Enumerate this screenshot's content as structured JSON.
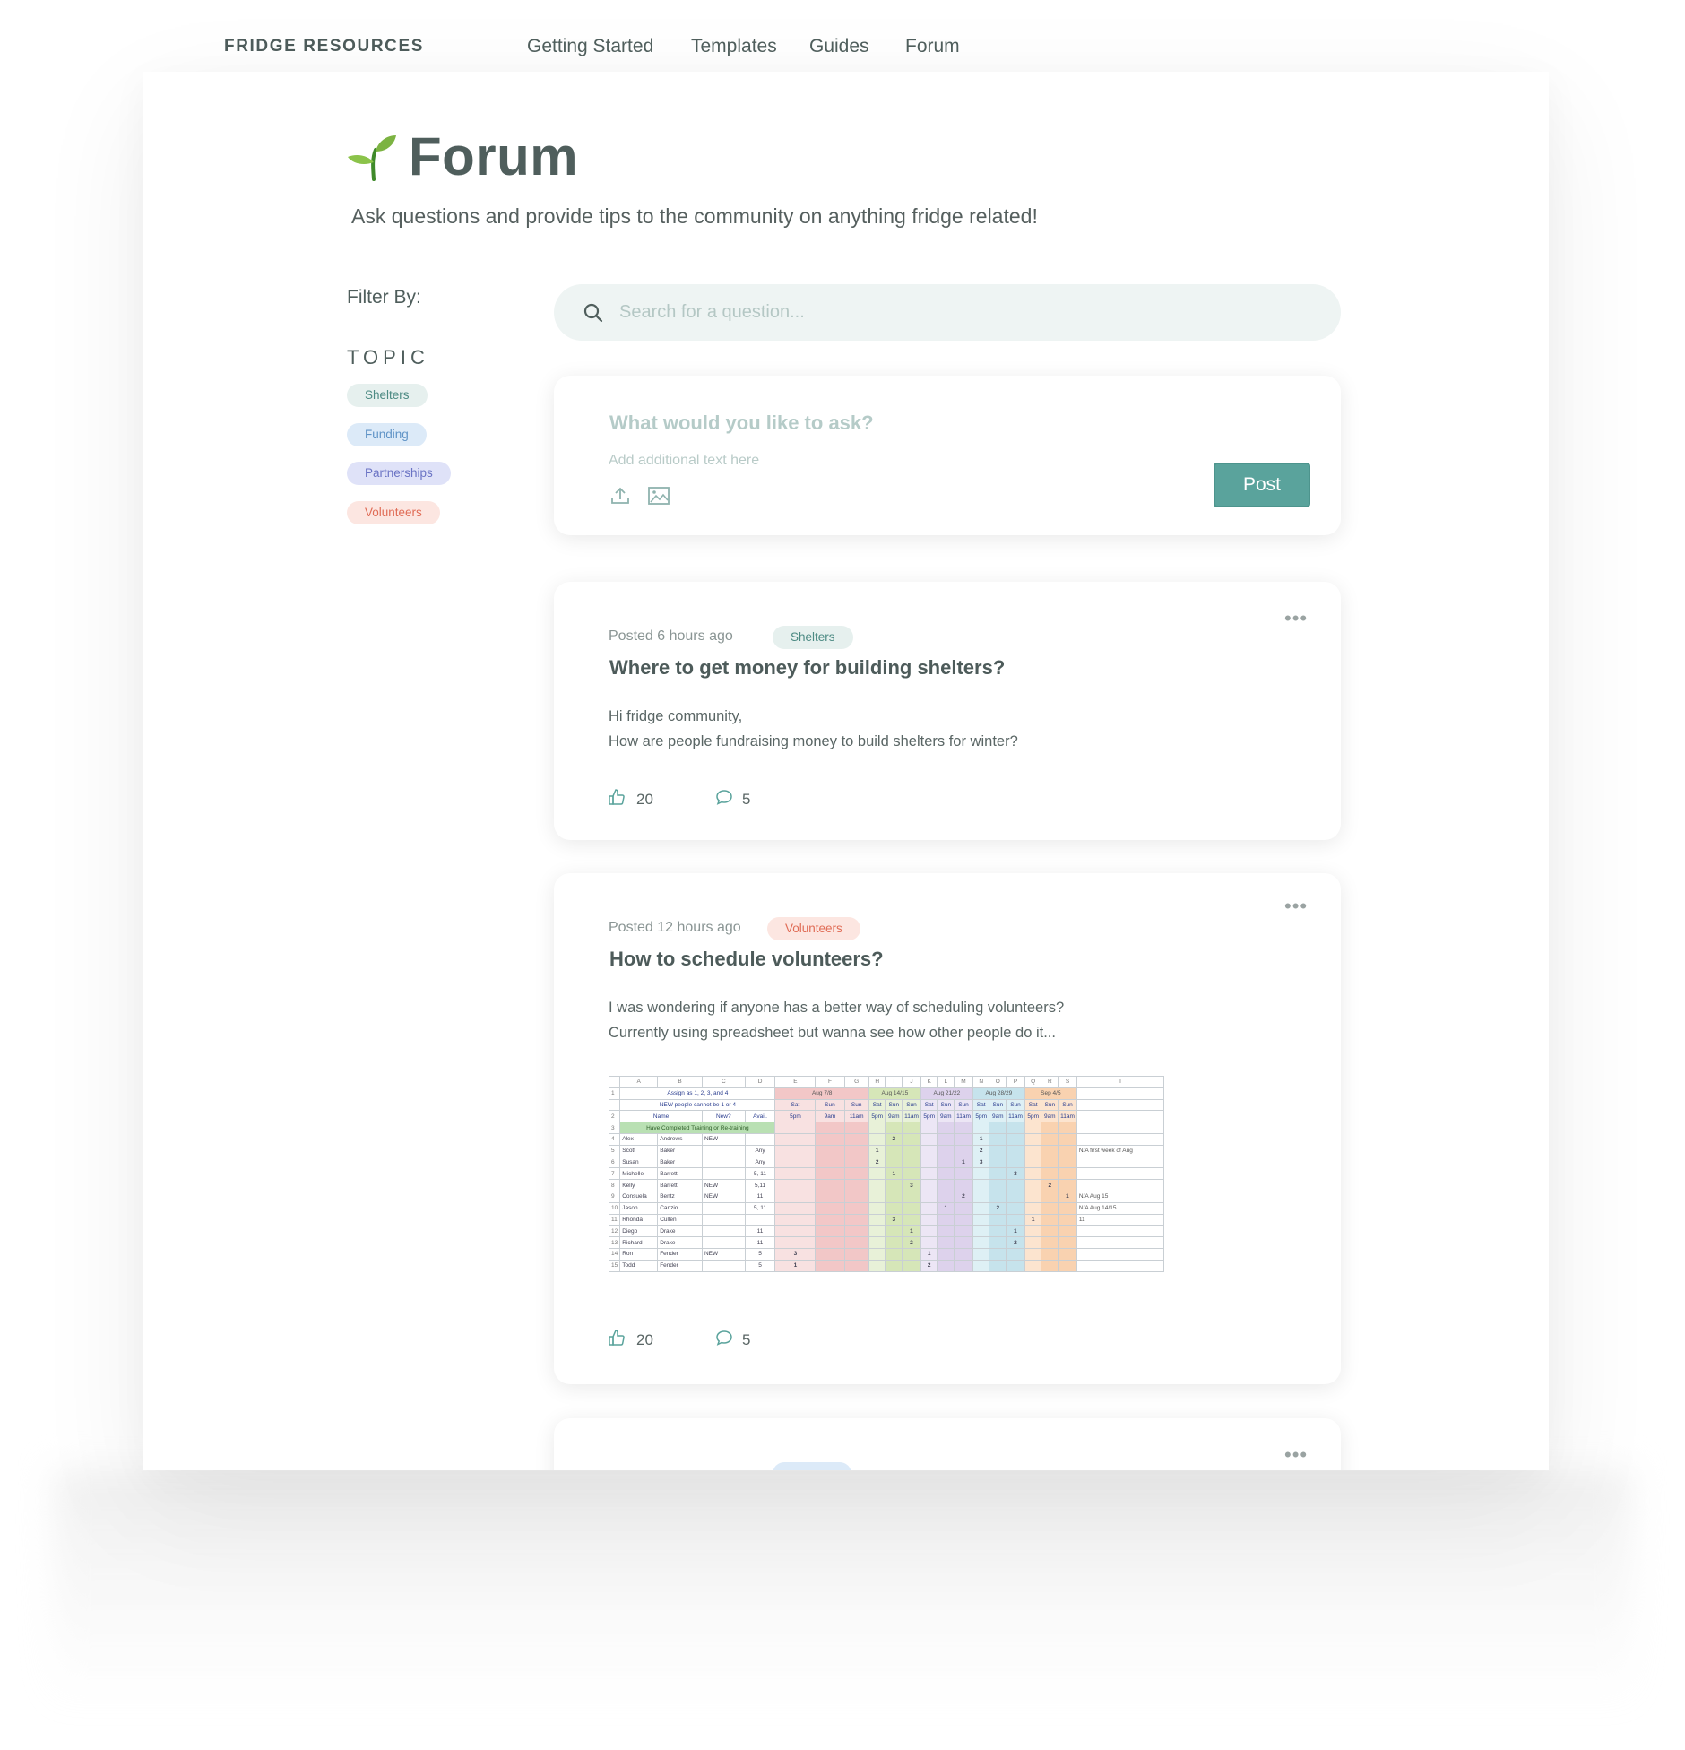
{
  "nav": {
    "brand": "FRIDGE RESOURCES",
    "links": [
      "Getting Started",
      "Templates",
      "Guides",
      "Forum"
    ]
  },
  "header": {
    "icon": "seedling-icon",
    "title": "Forum",
    "subtitle": "Ask questions and provide tips to the community on anything fridge related!"
  },
  "filter": {
    "label": "Filter By:",
    "topic_label": "TOPIC",
    "topics": [
      "Shelters",
      "Funding",
      "Partnerships",
      "Volunteers"
    ]
  },
  "search": {
    "placeholder": "Search for a question..."
  },
  "ask": {
    "title_placeholder": "What would you like to ask?",
    "text_placeholder": "Add additional text here",
    "post_label": "Post"
  },
  "posts": [
    {
      "meta": "Posted 6 hours ago",
      "tag": "Shelters",
      "title": "Where to get money for building shelters?",
      "body": [
        "Hi fridge community,",
        "How are people fundraising money to build shelters for winter?"
      ],
      "likes": "20",
      "comments": "5"
    },
    {
      "meta": "Posted 12 hours ago",
      "tag": "Volunteers",
      "title": "How to schedule volunteers?",
      "body": [
        "I was wondering if anyone has a better way of scheduling volunteers?",
        "Currently using spreadsheet but wanna see how other people do it..."
      ],
      "likes": "20",
      "comments": "5"
    }
  ],
  "sheet": {
    "cols": [
      "",
      "A",
      "B",
      "C",
      "D",
      "E",
      "F",
      "G",
      "H",
      "I",
      "J",
      "K",
      "L",
      "M",
      "N",
      "O",
      "P",
      "Q",
      "R",
      "S",
      "T"
    ],
    "note": [
      "Assign as 1, 2, 3, and 4",
      "NEW people cannot be 1 or 4"
    ],
    "weeks": [
      "Aug 7/8",
      "Aug 14/15",
      "Aug 21/22",
      "Aug 28/29",
      "Sep 4/5"
    ],
    "shift_top": [
      "Sat",
      "Sun",
      "Sun"
    ],
    "shift_bottom": [
      "5pm",
      "9am",
      "11am"
    ],
    "headers": [
      "Name",
      "New?",
      "Avail."
    ],
    "banner": "Have Completed Training or Re-training",
    "rows": [
      [
        "Alex",
        "Andrews",
        "NEW",
        ""
      ],
      [
        "Scott",
        "Baker",
        "",
        "Any"
      ],
      [
        "Susan",
        "Baker",
        "",
        "Any"
      ],
      [
        "Michelle",
        "Barrett",
        "",
        "5, 11"
      ],
      [
        "Kelly",
        "Barrett",
        "NEW",
        "5,11"
      ],
      [
        "Consuela",
        "Bentz",
        "NEW",
        "11"
      ],
      [
        "Jason",
        "Canzio",
        "",
        "5, 11"
      ],
      [
        "Rhonda",
        "Cullen",
        "",
        ""
      ],
      [
        "Diego",
        "Drake",
        "",
        "11"
      ],
      [
        "Richard",
        "Drake",
        "",
        "11"
      ],
      [
        "Ron",
        "Fender",
        "NEW",
        "5"
      ],
      [
        "Todd",
        "Fender",
        "",
        "5"
      ]
    ],
    "notes": [
      "N/A first week of Aug",
      "N/A Aug 15",
      "N/A Aug 14/15",
      "11"
    ]
  },
  "colors": {
    "accent": "#5aa39c",
    "text": "#4f5e5c"
  }
}
